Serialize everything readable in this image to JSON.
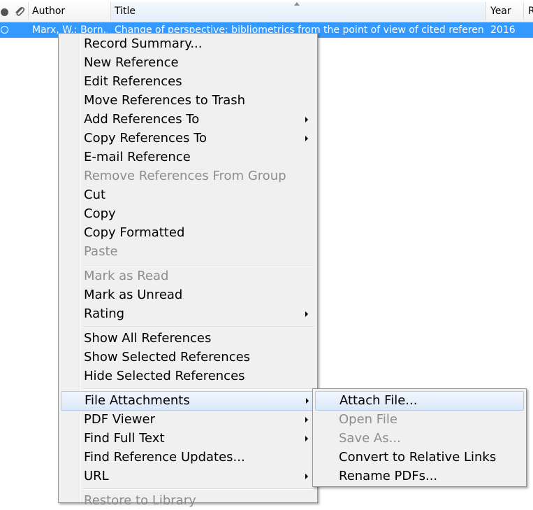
{
  "table": {
    "columns": {
      "author": "Author",
      "title": "Title",
      "year": "Year",
      "rating_partial": "R"
    },
    "selected_row": {
      "author": "Marx, W.; Born...",
      "title": "Change of perspective: bibliometrics from the point of view of cited reference...",
      "year": "2016"
    }
  },
  "context_menu": {
    "items": [
      {
        "label": "Record Summary...",
        "disabled": false,
        "submenu": false
      },
      {
        "label": "New Reference",
        "disabled": false,
        "submenu": false
      },
      {
        "label": "Edit References",
        "disabled": false,
        "submenu": false
      },
      {
        "label": "Move References to Trash",
        "disabled": false,
        "submenu": false
      },
      {
        "label": "Add References To",
        "disabled": false,
        "submenu": true
      },
      {
        "label": "Copy References To",
        "disabled": false,
        "submenu": true
      },
      {
        "label": "E-mail Reference",
        "disabled": false,
        "submenu": false
      },
      {
        "label": "Remove References From Group",
        "disabled": true,
        "submenu": false
      },
      {
        "label": "Cut",
        "disabled": false,
        "submenu": false
      },
      {
        "label": "Copy",
        "disabled": false,
        "submenu": false
      },
      {
        "label": "Copy Formatted",
        "disabled": false,
        "submenu": false
      },
      {
        "label": "Paste",
        "disabled": true,
        "submenu": false
      },
      {
        "label": "Mark as Read",
        "disabled": true,
        "submenu": false
      },
      {
        "label": "Mark as Unread",
        "disabled": false,
        "submenu": false
      },
      {
        "label": "Rating",
        "disabled": false,
        "submenu": true
      },
      {
        "label": "Show All References",
        "disabled": false,
        "submenu": false
      },
      {
        "label": "Show Selected References",
        "disabled": false,
        "submenu": false
      },
      {
        "label": "Hide Selected References",
        "disabled": false,
        "submenu": false
      },
      {
        "label": "File Attachments",
        "disabled": false,
        "submenu": true,
        "highlighted": true
      },
      {
        "label": "PDF Viewer",
        "disabled": false,
        "submenu": true
      },
      {
        "label": "Find Full Text",
        "disabled": false,
        "submenu": true
      },
      {
        "label": "Find Reference Updates...",
        "disabled": false,
        "submenu": false
      },
      {
        "label": "URL",
        "disabled": false,
        "submenu": true
      },
      {
        "label": "Restore to Library",
        "disabled": true,
        "submenu": false
      }
    ]
  },
  "file_attachments_submenu": {
    "items": [
      {
        "label": "Attach File...",
        "disabled": false,
        "highlighted": true
      },
      {
        "label": "Open File",
        "disabled": true
      },
      {
        "label": "Save As...",
        "disabled": true
      },
      {
        "label": "Convert to Relative Links",
        "disabled": false
      },
      {
        "label": "Rename PDFs...",
        "disabled": false
      }
    ]
  },
  "colors": {
    "selection": "#3399ff",
    "menu_bg": "#f0f0f0",
    "disabled_text": "#8d8d8d",
    "hover_border": "#b3cbe9"
  },
  "icons": [
    "read-status-dot-icon",
    "paperclip-icon",
    "sort-ascending-icon",
    "submenu-arrow-icon",
    "unread-ring-icon"
  ]
}
